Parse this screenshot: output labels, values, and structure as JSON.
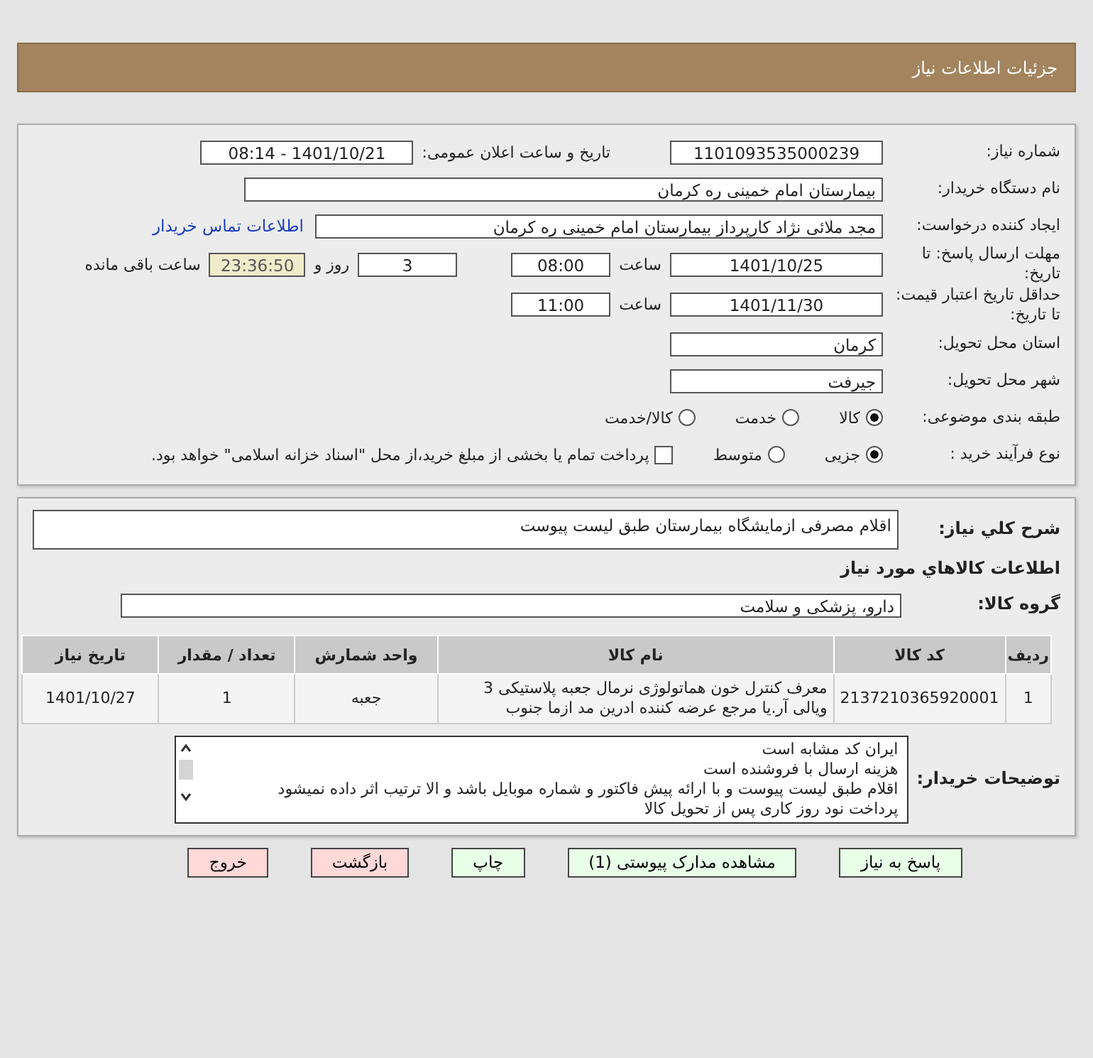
{
  "header": {
    "title": "جزئیات اطلاعات نیاز"
  },
  "need_number": {
    "label": "شماره نیاز:",
    "value": "1101093535000239"
  },
  "announce": {
    "label": "تاریخ و ساعت اعلان عمومی:",
    "value": "1401/10/21 - 08:14"
  },
  "buyer_org": {
    "label": "نام دستگاه خریدار:",
    "value": "بیمارستان امام خمینی  ره  کرمان"
  },
  "requester": {
    "label": "ایجاد کننده درخواست:",
    "value": "مجد ملائی نژاد کارپرداز بیمارستان امام خمینی  ره  کرمان",
    "link": "اطلاعات تماس خریدار"
  },
  "deadline": {
    "label": "مهلت ارسال پاسخ: تا تاریخ:",
    "date": "1401/10/25",
    "time_label": "ساعت",
    "time": "08:00",
    "days": "3",
    "days_label": "روز و",
    "remaining": "23:36:50",
    "remaining_label": "ساعت باقی مانده"
  },
  "price_validity": {
    "label": "حداقل تاریخ اعتبار قیمت: تا تاریخ:",
    "date": "1401/11/30",
    "time_label": "ساعت",
    "time": "11:00"
  },
  "province": {
    "label": "استان محل تحویل:",
    "value": "کرمان"
  },
  "city": {
    "label": "شهر محل تحویل:",
    "value": "جیرفت"
  },
  "category": {
    "label": "طبقه بندی موضوعی:",
    "options": [
      {
        "label": "کالا",
        "selected": true
      },
      {
        "label": "خدمت",
        "selected": false
      },
      {
        "label": "کالا/خدمت",
        "selected": false
      }
    ]
  },
  "purchase_type": {
    "label": "نوع فرآیند خرید :",
    "options": [
      {
        "label": "جزیی",
        "selected": true
      },
      {
        "label": "متوسط",
        "selected": false
      }
    ],
    "payment": {
      "label": "پرداخت تمام یا بخشی از مبلغ خرید،از محل \"اسناد خزانه اسلامی\" خواهد بود.",
      "checked": false
    }
  },
  "description": {
    "label": "شرح کلي نياز:",
    "value": "اقلام مصرفی ازمایشگاه بیمارستان طبق  لیست پیوست"
  },
  "goods_title": "اطلاعات کالاهاي مورد نياز",
  "goods_group": {
    "label": "گروه کالا:",
    "value": "دارو، پزشکی و سلامت"
  },
  "table": {
    "columns": [
      "ردیف",
      "کد کالا",
      "نام کالا",
      "واحد شمارش",
      "تعداد / مقدار",
      "تاریخ نیاز"
    ],
    "rows": [
      [
        "1",
        "2137210365920001",
        "معرف کنترل خون هماتولوژی نرمال جعبه پلاستیکی 3 ویالی آر.یا مرجع عرضه کننده ادرین مد ازما جنوب",
        "جعبه",
        "1",
        "1401/10/27"
      ]
    ]
  },
  "buyer_notes": {
    "label": "توضیحات خریدار:",
    "lines": [
      "ایران کد مشابه است",
      "هزینه ارسال با فروشنده است",
      "اقلام طبق لیست پیوست و با ارائه پیش فاکتور و شماره موبایل باشد و الا ترتیب اثر داده نمیشود",
      "پرداخت نود روز کاری پس از تحویل کالا"
    ]
  },
  "buttons": [
    {
      "label": "پاسخ به نیاز",
      "kind": "green"
    },
    {
      "label": "مشاهده مدارک پیوستی (1)",
      "kind": "green"
    },
    {
      "label": "چاپ",
      "kind": "green"
    },
    {
      "label": "بازگشت",
      "kind": "red"
    },
    {
      "label": "خروج",
      "kind": "red"
    }
  ]
}
